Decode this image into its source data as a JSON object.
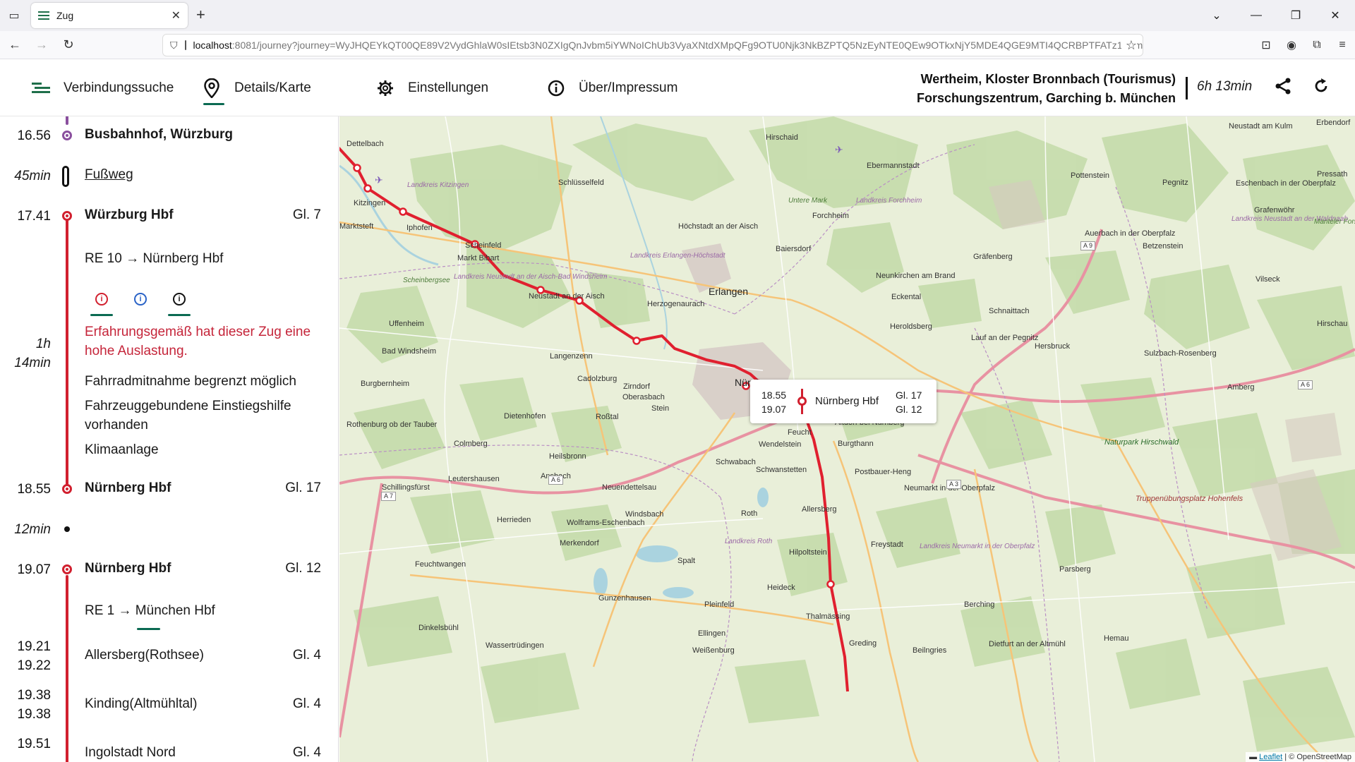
{
  "browser": {
    "tab_title": "Zug",
    "url_host": "localhost",
    "url_rest": ":8081/journey?journey=WyJHQEYkQT00QE89V2VydGhlaW0sIEtsb3N0ZXIgQnJvbm5iYWNoIChUb3VyaXNtdXMpQFg9OTU0Njk3NkBZPTQ5NzEyNTE0QEw9OTkxNjY5MDE4QGE9MTI4QCRBPTFATz1Ccm9ubm"
  },
  "app": {
    "tabs": [
      {
        "label": "Verbindungssuche",
        "icon": "route-search-icon"
      },
      {
        "label": "Details/Karte",
        "icon": "map-pin-icon"
      },
      {
        "label": "Einstellungen",
        "icon": "gear-icon"
      },
      {
        "label": "Über/Impressum",
        "icon": "info-icon"
      }
    ],
    "route_from": "Wertheim, Kloster Bronnbach (Tourismus)",
    "route_to": "Forschungszentrum, Garching b. München",
    "duration": "6h 13min"
  },
  "journey": {
    "stop1": {
      "time": "16.56",
      "name": "Busbahnhof, Würzburg"
    },
    "walk": {
      "duration": "45min",
      "label": "Fußweg"
    },
    "stop2": {
      "time": "17.41",
      "name": "Würzburg Hbf",
      "platform": "Gl. 7"
    },
    "train1": {
      "label": "RE 10 → Nürnberg Hbf",
      "duration_a": "1h",
      "duration_b": "14min"
    },
    "notice": "Erfahrungsgemäß hat dieser Zug eine hohe Auslastung.",
    "attributes": [
      "Fahrradmitnahme begrenzt möglich",
      "Fahrzeuggebundene Einstiegshilfe vorhanden",
      "Klimaanlage"
    ],
    "stop3": {
      "time": "18.55",
      "name": "Nürnberg Hbf",
      "platform": "Gl. 17"
    },
    "transfer": {
      "duration": "12min"
    },
    "stop4": {
      "time": "19.07",
      "name": "Nürnberg Hbf",
      "platform": "Gl. 12"
    },
    "train2": {
      "label": "RE 1 → München Hbf"
    },
    "stop5": {
      "arr": "19.21",
      "dep": "19.22",
      "name": "Allersberg(Rothsee)",
      "platform": "Gl. 4"
    },
    "stop6": {
      "arr": "19.38",
      "dep": "19.38",
      "name": "Kinding(Altmühltal)",
      "platform": "Gl. 4"
    },
    "stop7": {
      "arr": "19.51",
      "name": "Ingolstadt Nord",
      "platform": "Gl. 4"
    }
  },
  "map": {
    "popup": {
      "arr": "18.55",
      "dep": "19.07",
      "station": "Nürnberg Hbf",
      "plat_arr": "Gl. 17",
      "plat_dep": "Gl. 12"
    },
    "labels": {
      "dettelbach": "Dettelbach",
      "hirschaid": "Hirschaid",
      "ebermannstadt": "Ebermannstadt",
      "neustadt_kulm": "Neustadt am Kulm",
      "erbendorf": "Erbendorf",
      "kitzingen": "Kitzingen",
      "lk_kitzingen": "Landkreis Kitzingen",
      "schluesselfeld": "Schlüsselfeld",
      "pottenstein": "Pottenstein",
      "pegnitz": "Pegnitz",
      "eschenbach": "Eschenbach in der Oberpfalz",
      "pressath": "Pressath",
      "marktsteft": "Marktsteft",
      "iphofen": "Iphofen",
      "untere_mark": "Untere Mark",
      "forchheim": "Forchheim",
      "lk_forchheim": "Landkreis Forchheim",
      "hoechstadt": "Höchstadt an der Aisch",
      "grafenwoehr": "Grafenwöhr",
      "auerbach": "Auerbach in der Oberpfalz",
      "betzenstein": "Betzenstein",
      "lk_neustadt_waldnaab": "Landkreis Neustadt an der Waldnaab",
      "manteler": "Manteler Forst",
      "scheinfeld": "Scheinfeld",
      "baiersdorf": "Baiersdorf",
      "lk_erlangen": "Landkreis Erlangen-Höchstadt",
      "markt_bibart": "Markt Bibart",
      "grafenberg": "Gräfenberg",
      "neunkirchen": "Neunkirchen am Brand",
      "scheinbergsee": "Scheinbergsee",
      "lk_neustadt_aisch": "Landkreis Neustadt an der Aisch-Bad Windsheim",
      "vilseck": "Vilseck",
      "erlangen": "Erlangen",
      "eckental": "Eckental",
      "neustadt_aisch": "Neustadt an der Aisch",
      "herzogenaurach": "Herzogenaurach",
      "uffenheim": "Uffenheim",
      "schnaittach": "Schnaittach",
      "hirschau": "Hirschau",
      "heroldsberg": "Heroldsberg",
      "lauf": "Lauf an der Pegnitz",
      "hersbruck": "Hersbruck",
      "bad_windsheim": "Bad Windsheim",
      "langenzenn": "Langenzenn",
      "sulzbach": "Sulzbach-Rosenberg",
      "burgbernheim": "Burgbernheim",
      "cadolzburg": "Cadolzburg",
      "nuernberg": "Nürnberg",
      "zirndorf": "Zirndorf",
      "oberasbach": "Oberasbach",
      "amberg": "Amberg",
      "stein": "Stein",
      "dietenhofen": "Dietenhofen",
      "rossal": "Roßtal",
      "rothenburg": "Rothenburg ob der Tauber",
      "altdorf": "Altdorf bei Nürnberg",
      "feucht": "Feucht",
      "wendelstein": "Wendelstein",
      "burgthann": "Burgthann",
      "colmberg": "Colmberg",
      "heilsbronn": "Heilsbronn",
      "naturpark": "Naturpark Hirschwald",
      "schwabach": "Schwabach",
      "schwanstetten": "Schwanstetten",
      "leutershausen": "Leutershausen",
      "postbauer": "Postbauer-Heng",
      "ansbach": "Ansbach",
      "schillingsfuerst": "Schillingsfürst",
      "neuendettelsau": "Neuendettelsau",
      "neumarkt": "Neumarkt in der Oberpfalz",
      "truppen": "Truppenübungsplatz Hohenfels",
      "allersberg": "Allersberg",
      "herrieden": "Herrieden",
      "windsbach": "Windsbach",
      "roth": "Roth",
      "wolframs": "Wolframs-Eschenbach",
      "merkendorf": "Merkendorf",
      "lk_roth": "Landkreis Roth",
      "hilpoltstein": "Hilpoltstein",
      "freystadt": "Freystadt",
      "lk_neumarkt": "Landkreis Neumarkt in der Oberpfalz",
      "feuchtwangen": "Feuchtwangen",
      "spalt": "Spalt",
      "parsberg": "Parsberg",
      "gunzenhausen": "Gunzenhausen",
      "heideck": "Heideck",
      "pleinfeld": "Pleinfeld",
      "berching": "Berching",
      "thalmaessing": "Thalmässing",
      "dinkelsbuehl": "Dinkelsbühl",
      "ellingen": "Ellingen",
      "hemau": "Hemau",
      "greding": "Greding",
      "wassertruedingen": "Wassertrüdingen",
      "weissenburg": "Weißenburg",
      "beilngries": "Beilngries",
      "dietfurt": "Dietfurt an der Altmühl"
    },
    "roads": [
      "A 9",
      "A 6",
      "A 6",
      "A 3",
      "A 7",
      "A 6",
      "A 7"
    ],
    "attribution_leaflet": "Leaflet",
    "attribution_osm": "| © OpenStreetMap"
  },
  "colors": {
    "accent": "#0b6a52",
    "train": "#d1202f",
    "bus": "#8a4f9e",
    "warn": "#c5253a"
  }
}
